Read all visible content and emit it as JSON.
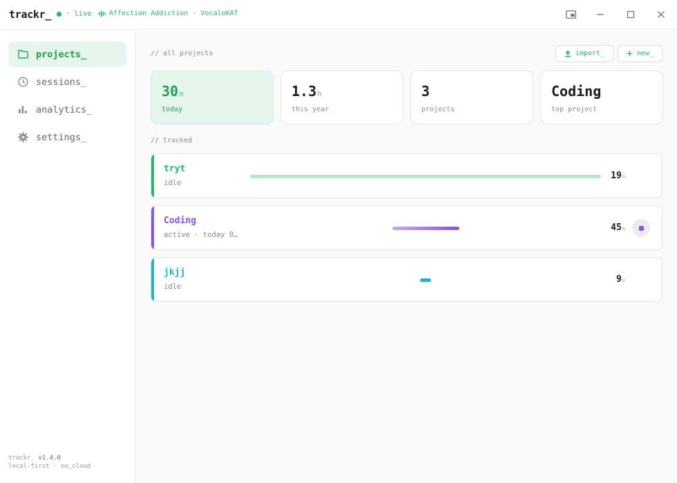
{
  "app": {
    "brand": "trackr_",
    "live_label": "live",
    "now_playing": "Affection Addiction · VocaloKAT",
    "colors": {
      "accent": "#2bb36b",
      "violet": "#8a52e8",
      "cyan": "#22b3cc"
    }
  },
  "window_controls": [
    "picture-in-picture-icon",
    "minimize-icon",
    "maximize-icon",
    "close-icon"
  ],
  "sidebar": {
    "items": [
      {
        "label": "projects_",
        "icon": "folder-icon",
        "active": true
      },
      {
        "label": "sessions_",
        "icon": "clock-icon",
        "active": false
      },
      {
        "label": "analytics_",
        "icon": "bar-chart-icon",
        "active": false
      },
      {
        "label": "settings_",
        "icon": "gear-icon",
        "active": false
      }
    ],
    "footer": {
      "version_name": "trackr_",
      "version": "v1.4.0",
      "tagline": "local-first · no_cloud"
    }
  },
  "main": {
    "section_all": "// all projects",
    "import_label": "import_",
    "new_label": "new_",
    "stats": [
      {
        "value": "30",
        "unit": "m",
        "label": "today"
      },
      {
        "value": "1.3",
        "unit": "h",
        "label": "this year"
      },
      {
        "value": "3",
        "unit": "",
        "label": "projects"
      },
      {
        "value": "Coding",
        "unit": "",
        "label": "top project"
      }
    ],
    "section_tracked": "// tracked",
    "projects": [
      {
        "name": "tryt",
        "status": "idle",
        "time": "19",
        "unit": "m",
        "color": "#2bb36b",
        "share": 1.0,
        "active": false
      },
      {
        "name": "Coding",
        "status": "active · today 0…",
        "time": "45",
        "unit": "m",
        "color": "#8a52e8",
        "share": 0.19,
        "active": true
      },
      {
        "name": "jkjj",
        "status": "idle",
        "time": "9",
        "unit": "m",
        "color": "#22b3cc",
        "share": 0.03,
        "active": false
      }
    ]
  }
}
